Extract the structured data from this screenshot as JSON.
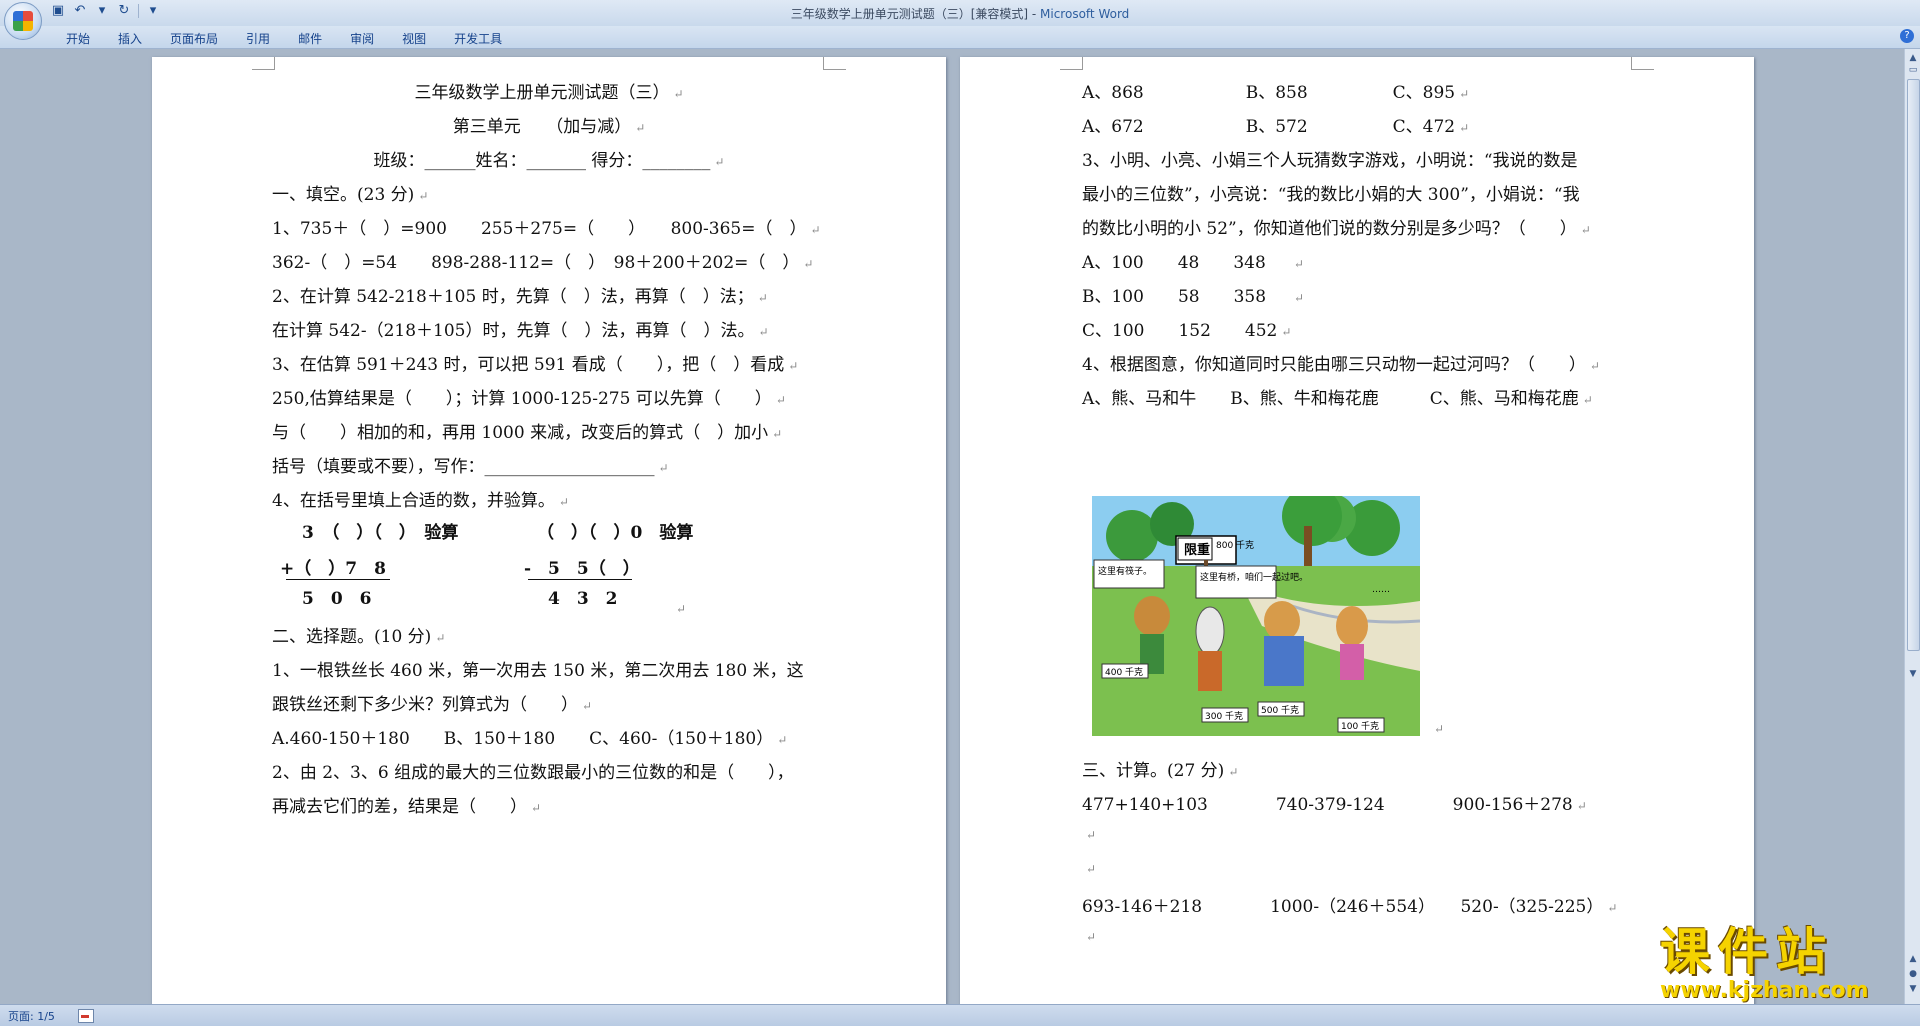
{
  "window": {
    "title": "三年级数学上册单元测试题（三）[兼容模式] - ",
    "app": "Microsoft Word"
  },
  "ribbon": {
    "tabs": [
      "开始",
      "插入",
      "页面布局",
      "引用",
      "邮件",
      "审阅",
      "视图",
      "开发工具"
    ]
  },
  "status": {
    "page": "页面: 1/5"
  },
  "left_page": {
    "title": "三年级数学上册单元测试题（三）",
    "subtitle": "第三单元　　（加与减）",
    "header": "班级：______姓名：_______ 得分：________",
    "s1": "一、填空。(23 分)",
    "q1a": "1、735＋（　）=900　　255＋275=（　　）　　800-365=（　）",
    "q1b": "362-（　）=54　　898-288-112=（　）　98＋200＋202=（　）",
    "q2a": "2、在计算 542-218＋105 时，先算（　）法，再算（　）法；",
    "q2b": "在计算 542-（218＋105）时，先算（　）法，再算（　）法。",
    "q3a": "3、在估算 591＋243 时，可以把 591 看成（　　），把（　）看成",
    "q3b": "250,估算结果是（　　）；计算 1000-125-275 可以先算（　　）",
    "q3c": "与（　　）相加的和，再用 1000 来减，改变后的算式（　）加小",
    "q3d": "括号（填要或不要），写作：____________________",
    "q4": "4、在括号里填上合适的数，并验算。",
    "v1a": "3　（　）（　）　验算",
    "v1b": "+（　）7　8",
    "v1c": "5　0　6",
    "v2a": "（　）（　）0　验算",
    "v2b": "-　5　5（　）",
    "v2c": "4　3　2",
    "s2": "二、选择题。(10 分)",
    "c1a": "1、一根铁丝长 460 米，第一次用去 150 米，第二次用去 180 米，这",
    "c1b": "跟铁丝还剩下多少米？列算式为（　　）",
    "c1c": "A.460-150＋180　　B、150＋180　　C、460-（150＋180）",
    "c2a": "2、由 2、3、6 组成的最大的三位数跟最小的三位数的和是（　　），",
    "c2b": "再减去它们的差，结果是（　　）"
  },
  "right_page": {
    "r1": "A、868　　　　　　B、858　　　　　C、895",
    "r2": "A、672　　　　　　B、572　　　　　C、472",
    "r3a": "3、小明、小亮、小娟三个人玩猜数字游戏，小明说：“我说的数是",
    "r3b": "最小的三位数”，小亮说：“我的数比小娟的大 300”，小娟说：“我",
    "r3c": "的数比小明的小 52”，你知道他们说的数分别是多少吗？（　　）",
    "r4": "A、100　　48　　348",
    "r5": "B、100　　58　　358",
    "r6": "C、100　　152　　452",
    "r7": "4、根据图意，你知道同时只能由哪三只动物一起过河吗？（　　）",
    "r8": "A、熊、马和牛　　B、熊、牛和梅花鹿　　　C、熊、马和梅花鹿",
    "illus": {
      "sign": "限重",
      "limit": "800 千克",
      "bubble1": "这里有筏子。",
      "bubble2": "这里有桥，咱们一起过吧。",
      "bubble3": "……",
      "w1": "400 千克",
      "w2": "300 千克",
      "w3": "500 千克",
      "w4": "100 千克"
    },
    "s3": "三、计算。(27 分)",
    "k1": "477+140+103　　　　740-379-124　　　　900-156＋278",
    "k2": "693-146＋218　　　　1000-（246＋554）　　520-（325-225）"
  },
  "watermark": {
    "title": "课件站",
    "url": "www.kjzhan.com"
  }
}
